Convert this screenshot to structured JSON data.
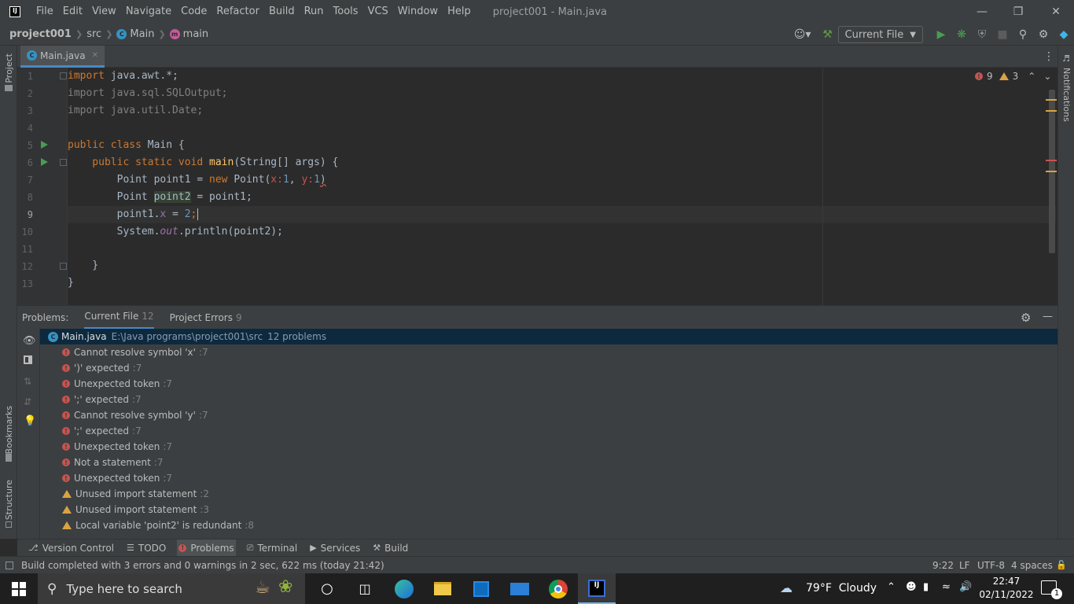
{
  "titlebar": {
    "menus": [
      "File",
      "Edit",
      "View",
      "Navigate",
      "Code",
      "Refactor",
      "Build",
      "Run",
      "Tools",
      "VCS",
      "Window",
      "Help"
    ],
    "title": "project001 - Main.java"
  },
  "navbar": {
    "crumbs": [
      "project001",
      "src",
      "Main",
      "main"
    ],
    "run_config": "Current File"
  },
  "leftstrip": {
    "project": "Project",
    "bookmarks": "Bookmarks",
    "structure": "Structure"
  },
  "rightstrip": {
    "notifications": "Notifications"
  },
  "editor": {
    "tab": "Main.java",
    "line_numbers": [
      "1",
      "2",
      "3",
      "4",
      "5",
      "6",
      "7",
      "8",
      "9",
      "10",
      "11",
      "12",
      "13"
    ],
    "errors": "9",
    "warnings": "3",
    "code": {
      "l1a": "import",
      "l1b": " java.awt.*;",
      "l2": "import java.sql.SQLOutput;",
      "l3": "import java.util.Date;",
      "l5a": "public class",
      "l5b": " Main {",
      "l6a": "    public static void ",
      "l6b": "main",
      "l6c": "(String[] args) {",
      "l7a": "        Point point1 = ",
      "l7b": "new",
      "l7c": " Point(",
      "l7d": "x:",
      "l7e": "1",
      "l7f": ", ",
      "l7g": "y:",
      "l7h": "1",
      "l7i": ")",
      "l8a": "        Point ",
      "l8b": "point2",
      "l8c": " = point1;",
      "l9a": "        point1.",
      "l9b": "x",
      "l9c": " = ",
      "l9d": "2",
      "l9e": ";",
      "l10a": "        System.",
      "l10b": "out",
      "l10c": ".println(point2);",
      "l12": "    }",
      "l13": "}"
    }
  },
  "problems": {
    "label": "Problems:",
    "tabs": [
      {
        "label": "Current File",
        "count": "12"
      },
      {
        "label": "Project Errors",
        "count": "9"
      }
    ],
    "file": {
      "name": "Main.java",
      "path": "E:\\Java programs\\project001\\src",
      "summary": "12 problems"
    },
    "items": [
      {
        "type": "error",
        "text": "Cannot resolve symbol 'x'",
        "line": ":7"
      },
      {
        "type": "error",
        "text": "')' expected",
        "line": ":7"
      },
      {
        "type": "error",
        "text": "Unexpected token",
        "line": ":7"
      },
      {
        "type": "error",
        "text": "';' expected",
        "line": ":7"
      },
      {
        "type": "error",
        "text": "Cannot resolve symbol 'y'",
        "line": ":7"
      },
      {
        "type": "error",
        "text": "';' expected",
        "line": ":7"
      },
      {
        "type": "error",
        "text": "Unexpected token",
        "line": ":7"
      },
      {
        "type": "error",
        "text": "Not a statement",
        "line": ":7"
      },
      {
        "type": "error",
        "text": "Unexpected token",
        "line": ":7"
      },
      {
        "type": "warning",
        "text": "Unused import statement",
        "line": ":2"
      },
      {
        "type": "warning",
        "text": "Unused import statement",
        "line": ":3"
      },
      {
        "type": "warning",
        "text": "Local variable 'point2' is redundant",
        "line": ":8"
      }
    ]
  },
  "bottomtabs": [
    "Version Control",
    "TODO",
    "Problems",
    "Terminal",
    "Services",
    "Build"
  ],
  "statusbar": {
    "message": "Build completed with 3 errors and 0 warnings in 2 sec, 622 ms (today 21:42)",
    "position": "9:22",
    "line_sep": "LF",
    "encoding": "UTF-8",
    "indent": "4 spaces"
  },
  "taskbar": {
    "search_placeholder": "Type here to search",
    "weather": "79°F  Cloudy",
    "time": "22:47",
    "date": "02/11/2022",
    "notif_count": "1"
  },
  "colors": {
    "accent": "#4a88c7",
    "error": "#c75450",
    "warning": "#d9a343",
    "run": "#499c54"
  }
}
